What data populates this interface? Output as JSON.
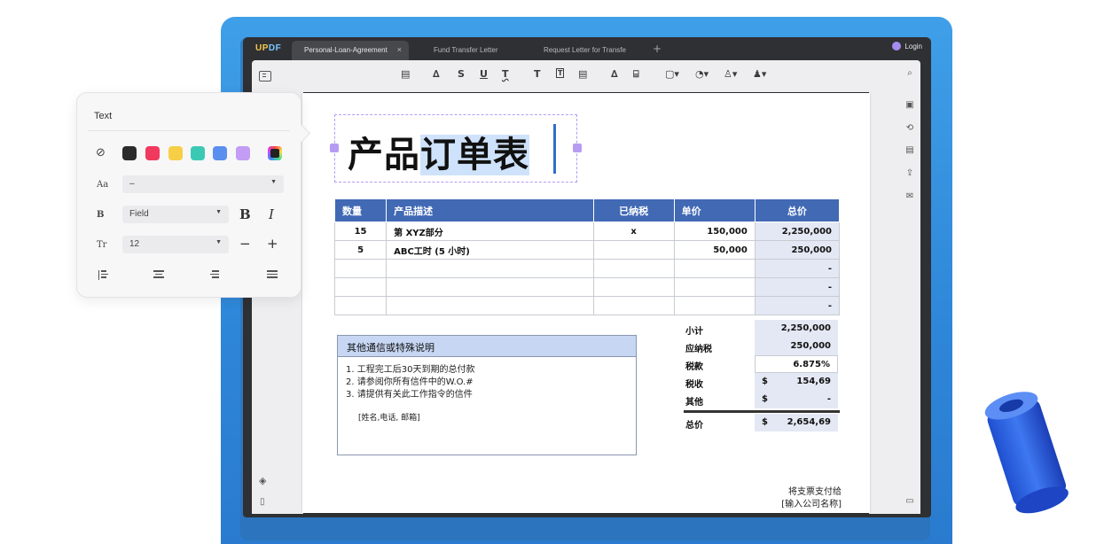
{
  "app": {
    "logo": [
      "UP",
      "DF"
    ],
    "tabs": [
      {
        "label": "Personal-Loan-Agreement",
        "active": true,
        "close": "×"
      },
      {
        "label": "Fund Transfer Letter",
        "active": false
      },
      {
        "label": "Request Letter for Transfe",
        "active": false
      }
    ],
    "add_tab": "+",
    "login": "Login"
  },
  "toolbar": {
    "icons": [
      "comment-icon",
      "highlighter-icon",
      "strikethrough-icon",
      "underline-icon",
      "squiggly-icon",
      "text-icon",
      "textbox-icon",
      "callout-icon",
      "pencil-icon",
      "eraser-icon",
      "shape-icon",
      "stamp-icon",
      "signature-icon",
      "attachment-icon"
    ],
    "glyphs": [
      "▤",
      "∆",
      "S",
      "U",
      "T",
      "T",
      "T",
      "▤",
      "∆",
      "⌸",
      "▢▾",
      "◔▾",
      "♙▾",
      "♟▾"
    ]
  },
  "document": {
    "title_plain": "产品",
    "title_selected": "订单表",
    "table": {
      "headers": [
        "数量",
        "产品描述",
        "已纳税",
        "单价",
        "总价"
      ],
      "rows": [
        [
          "15",
          "第 XYZ部分",
          "x",
          "150,000",
          "2,250,000"
        ],
        [
          "5",
          "ABC工时 (5 小时)",
          "",
          "50,000",
          "250,000"
        ],
        [
          "",
          "",
          "",
          "",
          "-"
        ],
        [
          "",
          "",
          "",
          "",
          "-"
        ],
        [
          "",
          "",
          "",
          "",
          "-"
        ]
      ]
    },
    "notes": {
      "heading": "其他通信或特殊说明",
      "lines": [
        "1. 工程完工后30天到期的总付款",
        "2. 请参阅你所有信件中的W.O.#",
        "3. 请提供有关此工作指令的信件"
      ],
      "signature": "[姓名,电话, 邮箱]"
    },
    "totals": [
      {
        "label": "小计",
        "currency": "",
        "value": "2,250,000"
      },
      {
        "label": "应纳税",
        "currency": "",
        "value": "250,000"
      },
      {
        "label": "税款",
        "currency": "",
        "value": "6.875%"
      },
      {
        "label": "税收",
        "currency": "$",
        "value": "154,69"
      },
      {
        "label": "其他",
        "currency": "$",
        "value": "-"
      },
      {
        "label": "总价",
        "currency": "$",
        "value": "2,654,69"
      }
    ],
    "payable_to": "将支票支付给",
    "company": "[输入公司名称]"
  },
  "text_panel": {
    "title": "Text",
    "colors": [
      "#2b2b2b",
      "#f0395c",
      "#f6cf46",
      "#3cc9b4",
      "#5a8ff0",
      "#c39cf5"
    ],
    "font_size_label": "Aa",
    "font_size_value": "–",
    "font_label": "B",
    "font_value": "Field",
    "bold": "B",
    "italic": "I",
    "size_label": "Tr",
    "size_value": "12",
    "minus": "−",
    "plus": "+"
  }
}
